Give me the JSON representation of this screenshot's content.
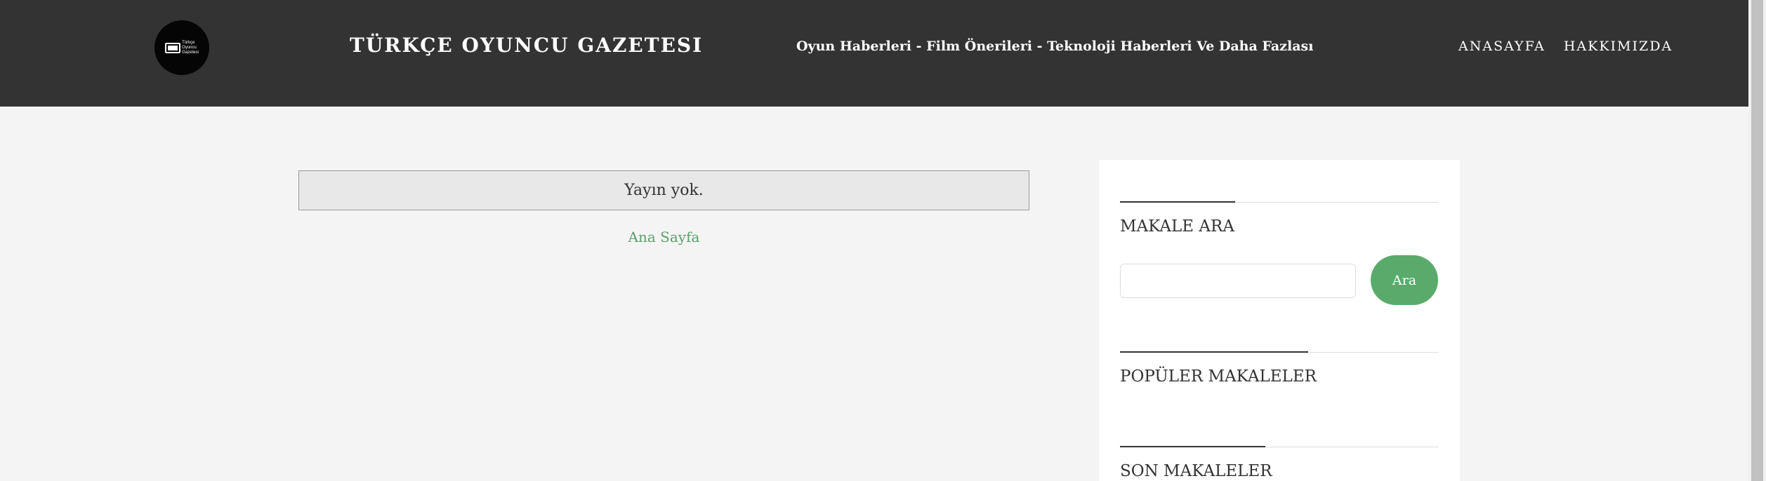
{
  "header": {
    "logo_text": [
      "Türkçe",
      "Oyuncu",
      "Gazetesi"
    ],
    "site_title": "TÜRKÇE OYUNCU GAZETESI",
    "tagline": "Oyun Haberleri - Film Önerileri - Teknoloji Haberleri Ve Daha Fazlası",
    "nav": [
      "ANASAYFA",
      "HAKKIMIZDA"
    ]
  },
  "main": {
    "notice": "Yayın yok.",
    "home_link": "Ana Sayfa"
  },
  "sidebar": {
    "search_title": "MAKALE ARA",
    "search_value": "",
    "search_button": "Ara",
    "popular_title": "POPÜLER MAKALELER",
    "recent_title": "SON MAKALELER"
  },
  "colors": {
    "header_bg": "#333333",
    "page_bg": "#f4f4f4",
    "accent_green": "#5aab6b",
    "link_green": "#5a9e6a"
  }
}
